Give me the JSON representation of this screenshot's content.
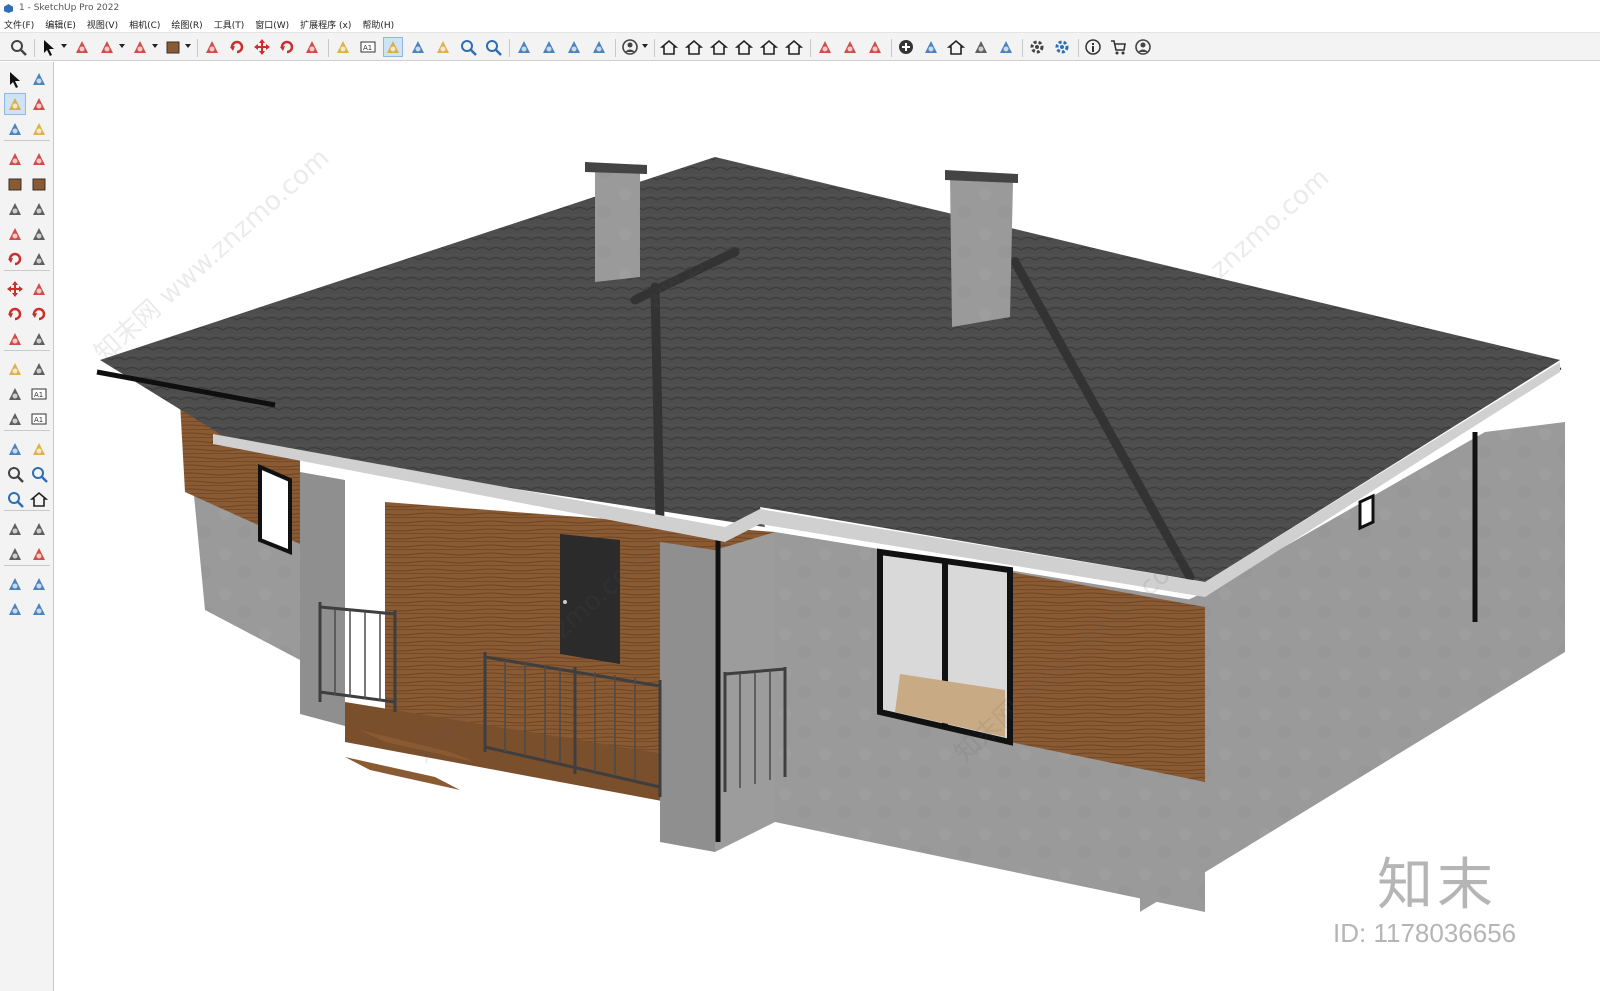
{
  "window": {
    "title": "1 - SketchUp Pro 2022"
  },
  "menu": {
    "items": [
      "文件(F)",
      "编辑(E)",
      "视图(V)",
      "相机(C)",
      "绘图(R)",
      "工具(T)",
      "窗口(W)",
      "扩展程序 (x)",
      "帮助(H)"
    ]
  },
  "toolbar": {
    "buttons": [
      "zoom-icon",
      "select-icon",
      "eraser-icon",
      "pencil-icon",
      "arc-icon",
      "rectangle-icon",
      "push-pull-icon",
      "follow-me-icon",
      "move-icon",
      "rotate-icon",
      "scale-icon",
      "tape-measure-icon",
      "text-icon",
      "paint-bucket-icon",
      "orbit-icon",
      "pan-icon",
      "zoom-window-icon",
      "zoom-extents-icon",
      "sandbox-icon",
      "layers-icon",
      "styles-icon",
      "components-icon",
      "user-icon",
      "iso-view-icon",
      "top-view-icon",
      "front-view-icon",
      "right-view-icon",
      "back-view-icon",
      "left-view-icon",
      "section-plane-icon",
      "section-display-icon",
      "section-cut-icon",
      "add-location-icon",
      "geo-icon",
      "warehouse-icon",
      "extension-icon",
      "cloud-icon",
      "settings-icon",
      "dynamic-components-icon",
      "info-icon",
      "cart-icon",
      "account-icon"
    ],
    "active_index": 13
  },
  "watermarks": {
    "site_text": "知末网 www.znzmo.com",
    "logo": "知末",
    "id_text": "ID: 1178036656"
  },
  "colors": {
    "roof": "#4a4a4a",
    "wall": "#9a9a9a",
    "wood": "#8a5a33",
    "chimney": "#8c8c8c"
  }
}
